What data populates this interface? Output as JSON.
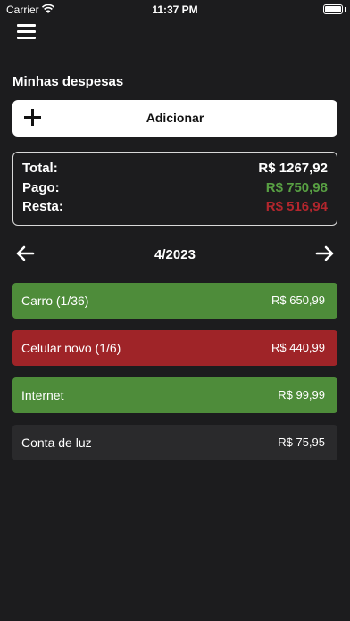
{
  "status_bar": {
    "carrier": "Carrier",
    "time": "11:37 PM"
  },
  "header": {
    "title": "Minhas despesas"
  },
  "add_button": {
    "label": "Adicionar"
  },
  "summary": {
    "total_label": "Total:",
    "total_value": "R$ 1267,92",
    "paid_label": "Pago:",
    "paid_value": "R$ 750,98",
    "remaining_label": "Resta:",
    "remaining_value": "R$ 516,94"
  },
  "period": {
    "label": "4/2023"
  },
  "expenses": [
    {
      "name": "Carro (1/36)",
      "amount": "R$ 650,99",
      "status": "paid"
    },
    {
      "name": "Celular novo (1/6)",
      "amount": "R$ 440,99",
      "status": "due"
    },
    {
      "name": "Internet",
      "amount": "R$ 99,99",
      "status": "paid"
    },
    {
      "name": "Conta de luz",
      "amount": "R$ 75,95",
      "status": "pending"
    }
  ],
  "colors": {
    "background": "#1c1c1e",
    "paid": "#4e8c3a",
    "due": "#9f2428",
    "pending": "#2a2a2c",
    "paid_text": "#58a043",
    "due_text": "#b3262d"
  }
}
